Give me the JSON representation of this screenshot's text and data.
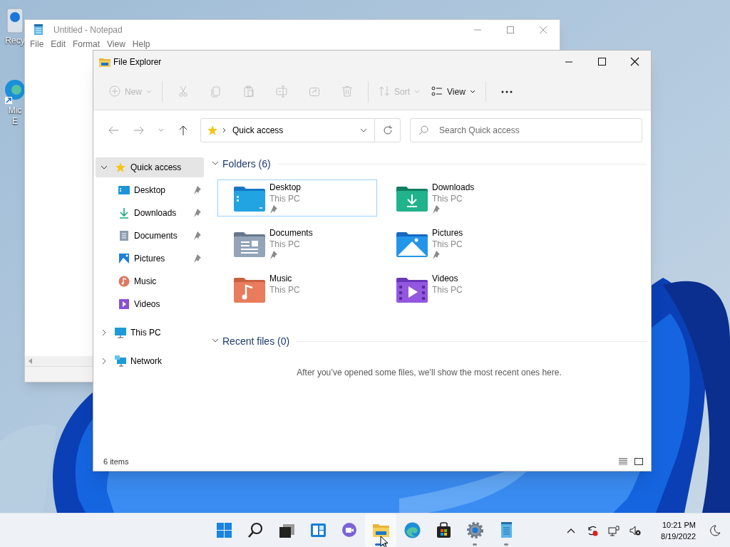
{
  "desktop_icons": [
    {
      "kind": "bin",
      "lines": [
        "Recy"
      ]
    },
    {
      "kind": "edge",
      "lines": [
        "Mic",
        "E"
      ]
    }
  ],
  "notepad": {
    "title": "Untitled - Notepad",
    "active": false,
    "menu": [
      "File",
      "Edit",
      "Format",
      "View",
      "Help"
    ]
  },
  "explorer": {
    "title": "File Explorer",
    "toolbar": [
      {
        "kind": "new",
        "label": "New",
        "disabled": true
      },
      {
        "kind": "separator"
      },
      {
        "kind": "cut",
        "disabled": true
      },
      {
        "kind": "copy",
        "disabled": true
      },
      {
        "kind": "paste",
        "disabled": true
      },
      {
        "kind": "rename",
        "disabled": true
      },
      {
        "kind": "share",
        "disabled": true
      },
      {
        "kind": "delete",
        "disabled": true
      },
      {
        "kind": "separator"
      },
      {
        "kind": "sort",
        "label": "Sort",
        "disabled": true
      },
      {
        "kind": "view",
        "label": "View",
        "disabled": false
      },
      {
        "kind": "separator"
      },
      {
        "kind": "more",
        "disabled": false
      }
    ],
    "address": {
      "location": "Quick access"
    },
    "search": {
      "placeholder": "Search Quick access"
    },
    "sidebar": [
      {
        "kind": "star",
        "label": "Quick access",
        "expanded": true,
        "selected": true,
        "children": [
          {
            "kind": "desktop",
            "label": "Desktop",
            "pinned": true,
            "selected": false
          },
          {
            "kind": "downloads",
            "label": "Downloads",
            "pinned": true,
            "selected": false
          },
          {
            "kind": "documents",
            "label": "Documents",
            "pinned": true,
            "selected": false
          },
          {
            "kind": "pictures",
            "label": "Pictures",
            "pinned": true,
            "selected": false
          },
          {
            "kind": "music",
            "label": "Music",
            "pinned": false,
            "selected": false
          },
          {
            "kind": "videos",
            "label": "Videos",
            "pinned": false,
            "selected": false
          }
        ]
      },
      {
        "kind": "pc",
        "label": "This PC",
        "expanded": false,
        "selected": false
      },
      {
        "kind": "network",
        "label": "Network",
        "expanded": false,
        "selected": false
      }
    ],
    "folders": {
      "heading": "Folders (6)",
      "expanded": true,
      "items": [
        {
          "kind": "desktop",
          "name": "Desktop",
          "location": "This PC",
          "pinned": true,
          "selected": true
        },
        {
          "kind": "downloads",
          "name": "Downloads",
          "location": "This PC",
          "pinned": true,
          "selected": false
        },
        {
          "kind": "documents",
          "name": "Documents",
          "location": "This PC",
          "pinned": true,
          "selected": false
        },
        {
          "kind": "pictures",
          "name": "Pictures",
          "location": "This PC",
          "pinned": true,
          "selected": false
        },
        {
          "kind": "music",
          "name": "Music",
          "location": "This PC",
          "pinned": false,
          "selected": false
        },
        {
          "kind": "videos",
          "name": "Videos",
          "location": "This PC",
          "pinned": false,
          "selected": false
        }
      ]
    },
    "recent": {
      "heading": "Recent files (0)",
      "expanded": true,
      "message": "After you’ve opened some files, we’ll show the most recent ones here."
    },
    "status_bar": {
      "count": "6 items"
    }
  },
  "taskbar": {
    "apps": [
      {
        "kind": "start",
        "open": false,
        "selected": false
      },
      {
        "kind": "search",
        "open": false,
        "selected": false
      },
      {
        "kind": "taskview",
        "open": false,
        "selected": false
      },
      {
        "kind": "widgets",
        "open": false,
        "selected": false
      },
      {
        "kind": "chat",
        "open": false,
        "selected": false
      },
      {
        "kind": "explorer",
        "open": true,
        "selected": true
      },
      {
        "kind": "edge",
        "open": false,
        "selected": false
      },
      {
        "kind": "store",
        "open": false,
        "selected": false
      },
      {
        "kind": "settings",
        "open": true,
        "selected": false
      },
      {
        "kind": "notepad",
        "open": true,
        "selected": false
      }
    ],
    "time": "10:21 PM",
    "date": "8/19/2022"
  }
}
